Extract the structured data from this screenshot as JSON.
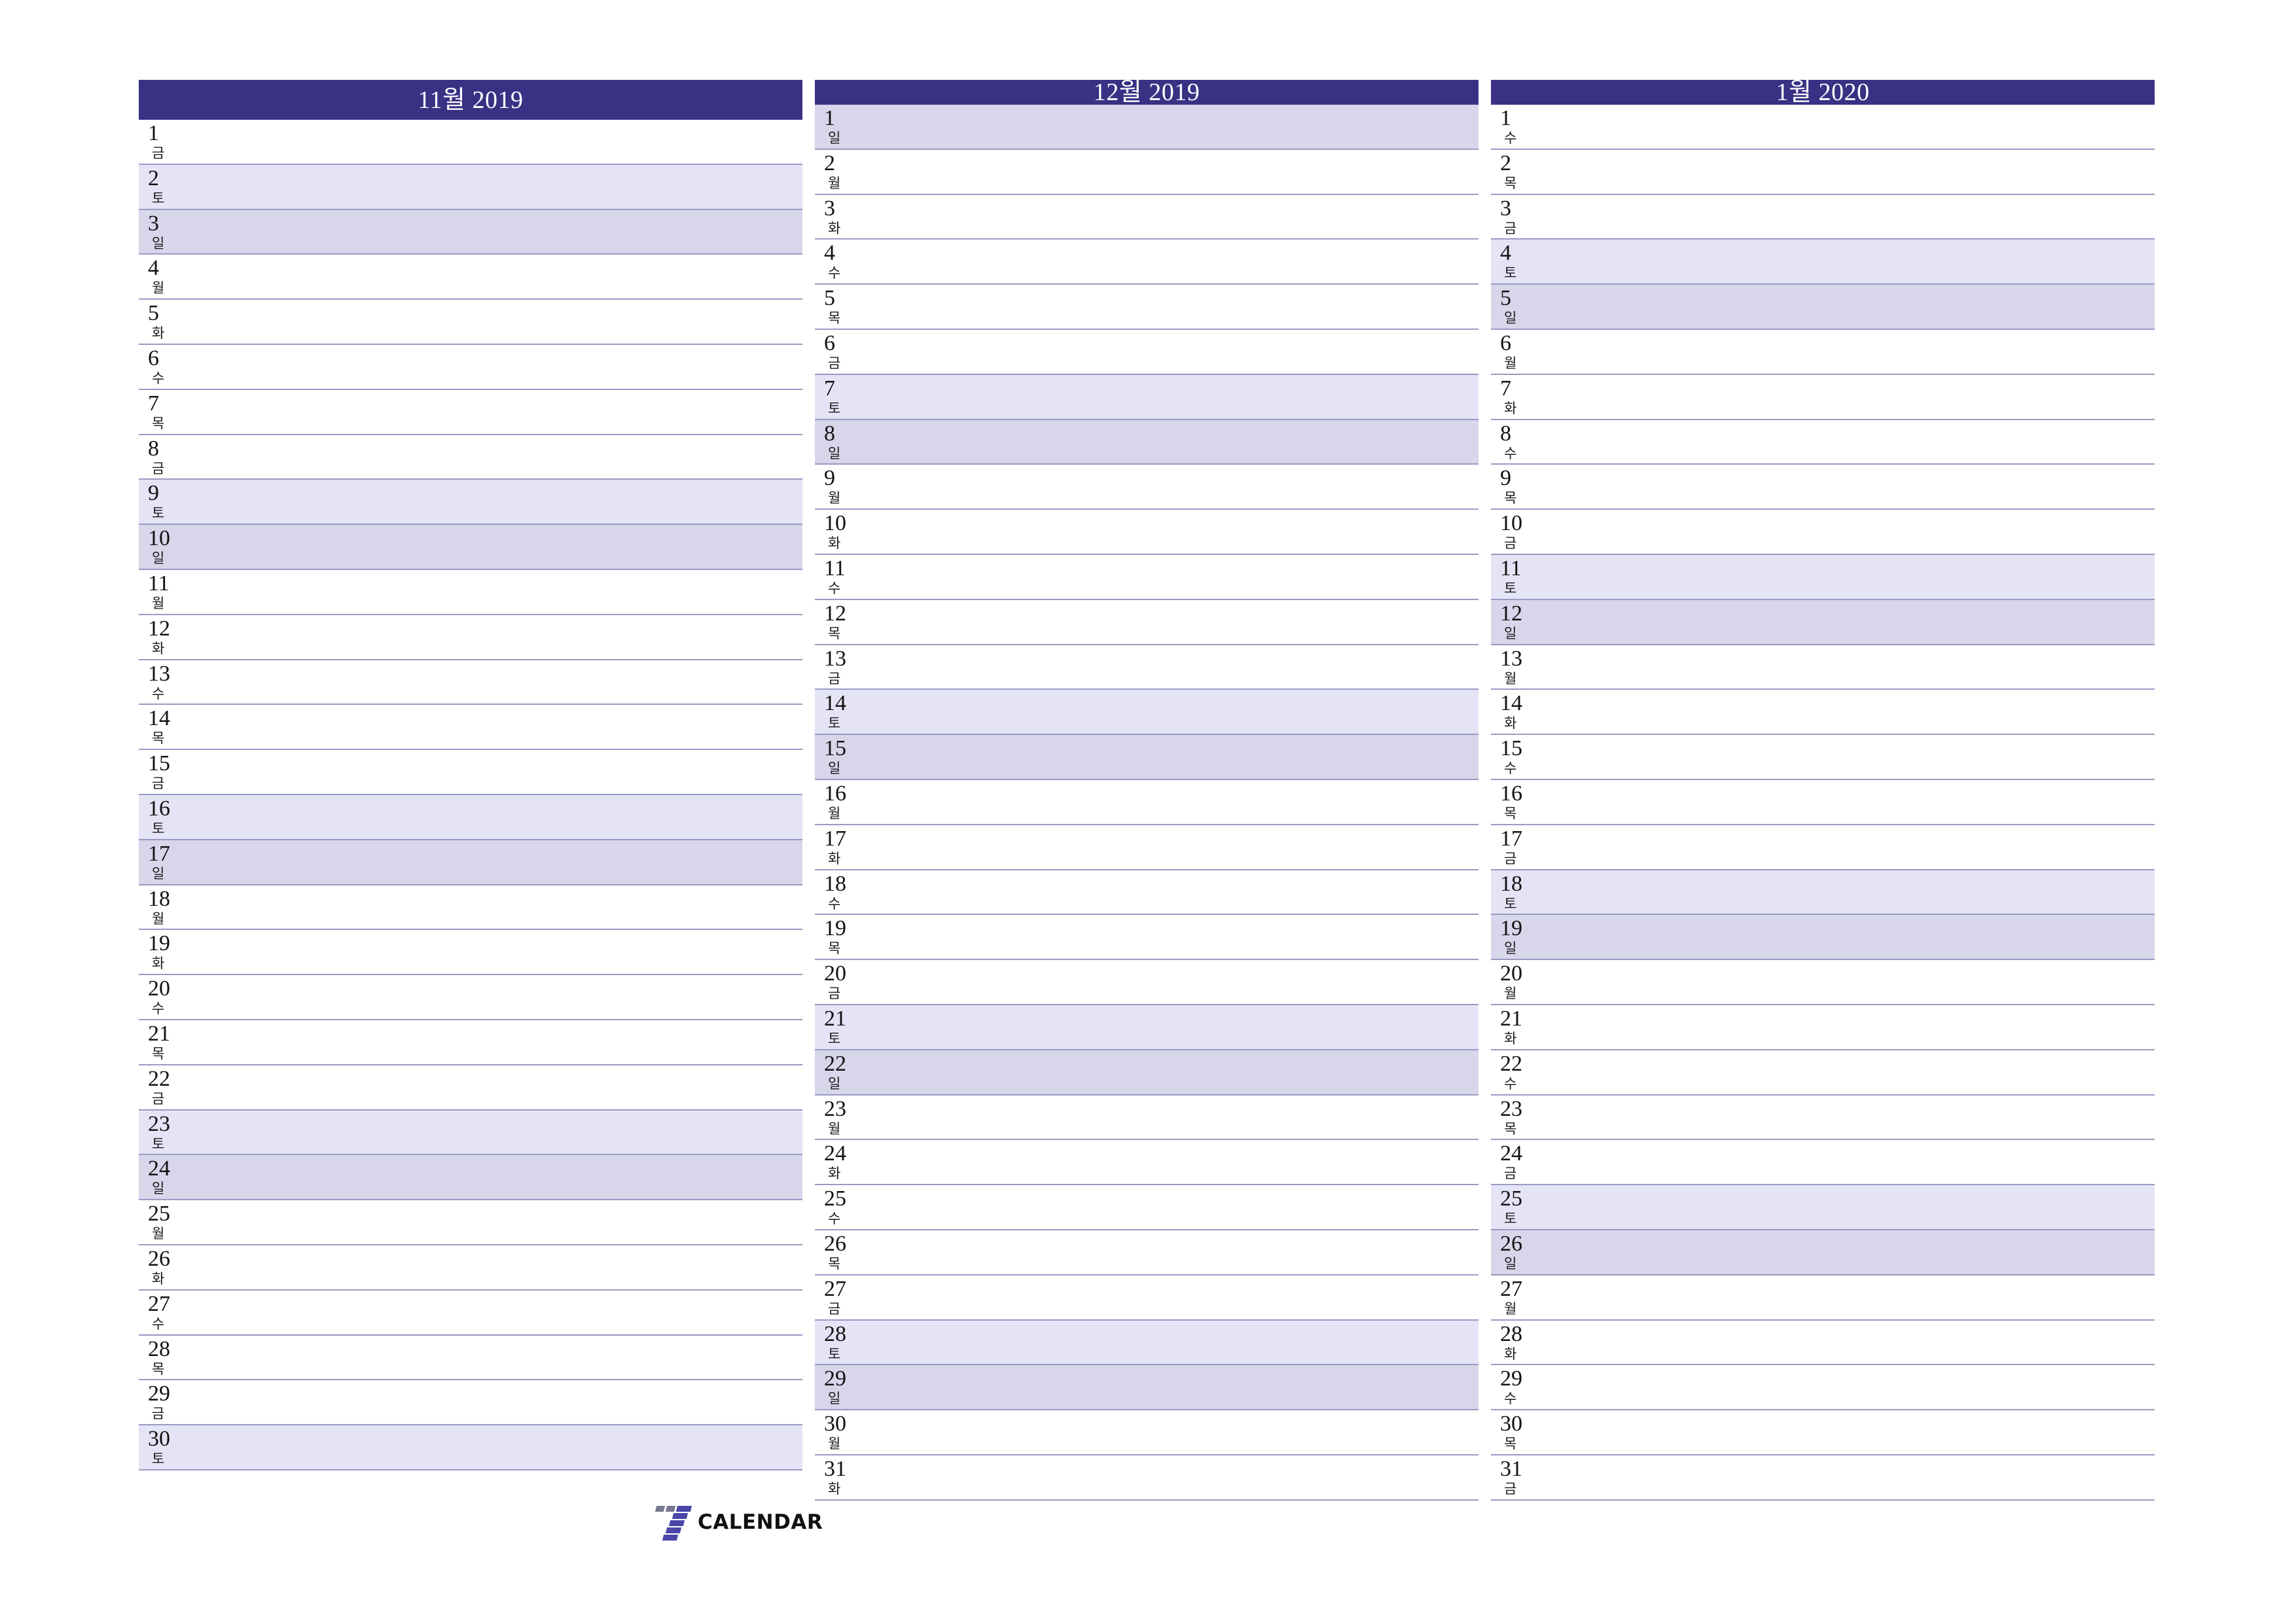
{
  "colors": {
    "header_bg": "#3a3185",
    "header_text": "#ffffff",
    "saturday_bg": "#e4e4f6",
    "sunday_bg": "#d8d6ea",
    "row_border": "#9a9ac4",
    "page_bg": "#ffffff",
    "logo_purple": "#4a46a8",
    "logo_gray": "#77778f"
  },
  "logo": {
    "mark_name": "seven-mark",
    "text": "CALENDAR"
  },
  "months": [
    {
      "title": "11월 2019",
      "days": [
        {
          "num": "1",
          "name": "금",
          "type": "weekday"
        },
        {
          "num": "2",
          "name": "토",
          "type": "sat"
        },
        {
          "num": "3",
          "name": "일",
          "type": "sun"
        },
        {
          "num": "4",
          "name": "월",
          "type": "weekday"
        },
        {
          "num": "5",
          "name": "화",
          "type": "weekday"
        },
        {
          "num": "6",
          "name": "수",
          "type": "weekday"
        },
        {
          "num": "7",
          "name": "목",
          "type": "weekday"
        },
        {
          "num": "8",
          "name": "금",
          "type": "weekday"
        },
        {
          "num": "9",
          "name": "토",
          "type": "sat"
        },
        {
          "num": "10",
          "name": "일",
          "type": "sun"
        },
        {
          "num": "11",
          "name": "월",
          "type": "weekday"
        },
        {
          "num": "12",
          "name": "화",
          "type": "weekday"
        },
        {
          "num": "13",
          "name": "수",
          "type": "weekday"
        },
        {
          "num": "14",
          "name": "목",
          "type": "weekday"
        },
        {
          "num": "15",
          "name": "금",
          "type": "weekday"
        },
        {
          "num": "16",
          "name": "토",
          "type": "sat"
        },
        {
          "num": "17",
          "name": "일",
          "type": "sun"
        },
        {
          "num": "18",
          "name": "월",
          "type": "weekday"
        },
        {
          "num": "19",
          "name": "화",
          "type": "weekday"
        },
        {
          "num": "20",
          "name": "수",
          "type": "weekday"
        },
        {
          "num": "21",
          "name": "목",
          "type": "weekday"
        },
        {
          "num": "22",
          "name": "금",
          "type": "weekday"
        },
        {
          "num": "23",
          "name": "토",
          "type": "sat"
        },
        {
          "num": "24",
          "name": "일",
          "type": "sun"
        },
        {
          "num": "25",
          "name": "월",
          "type": "weekday"
        },
        {
          "num": "26",
          "name": "화",
          "type": "weekday"
        },
        {
          "num": "27",
          "name": "수",
          "type": "weekday"
        },
        {
          "num": "28",
          "name": "목",
          "type": "weekday"
        },
        {
          "num": "29",
          "name": "금",
          "type": "weekday"
        },
        {
          "num": "30",
          "name": "토",
          "type": "sat"
        }
      ]
    },
    {
      "title": "12월 2019",
      "days": [
        {
          "num": "1",
          "name": "일",
          "type": "sun"
        },
        {
          "num": "2",
          "name": "월",
          "type": "weekday"
        },
        {
          "num": "3",
          "name": "화",
          "type": "weekday"
        },
        {
          "num": "4",
          "name": "수",
          "type": "weekday"
        },
        {
          "num": "5",
          "name": "목",
          "type": "weekday"
        },
        {
          "num": "6",
          "name": "금",
          "type": "weekday"
        },
        {
          "num": "7",
          "name": "토",
          "type": "sat"
        },
        {
          "num": "8",
          "name": "일",
          "type": "sun"
        },
        {
          "num": "9",
          "name": "월",
          "type": "weekday"
        },
        {
          "num": "10",
          "name": "화",
          "type": "weekday"
        },
        {
          "num": "11",
          "name": "수",
          "type": "weekday"
        },
        {
          "num": "12",
          "name": "목",
          "type": "weekday"
        },
        {
          "num": "13",
          "name": "금",
          "type": "weekday"
        },
        {
          "num": "14",
          "name": "토",
          "type": "sat"
        },
        {
          "num": "15",
          "name": "일",
          "type": "sun"
        },
        {
          "num": "16",
          "name": "월",
          "type": "weekday"
        },
        {
          "num": "17",
          "name": "화",
          "type": "weekday"
        },
        {
          "num": "18",
          "name": "수",
          "type": "weekday"
        },
        {
          "num": "19",
          "name": "목",
          "type": "weekday"
        },
        {
          "num": "20",
          "name": "금",
          "type": "weekday"
        },
        {
          "num": "21",
          "name": "토",
          "type": "sat"
        },
        {
          "num": "22",
          "name": "일",
          "type": "sun"
        },
        {
          "num": "23",
          "name": "월",
          "type": "weekday"
        },
        {
          "num": "24",
          "name": "화",
          "type": "weekday"
        },
        {
          "num": "25",
          "name": "수",
          "type": "weekday"
        },
        {
          "num": "26",
          "name": "목",
          "type": "weekday"
        },
        {
          "num": "27",
          "name": "금",
          "type": "weekday"
        },
        {
          "num": "28",
          "name": "토",
          "type": "sat"
        },
        {
          "num": "29",
          "name": "일",
          "type": "sun"
        },
        {
          "num": "30",
          "name": "월",
          "type": "weekday"
        },
        {
          "num": "31",
          "name": "화",
          "type": "weekday"
        }
      ]
    },
    {
      "title": "1월 2020",
      "days": [
        {
          "num": "1",
          "name": "수",
          "type": "weekday"
        },
        {
          "num": "2",
          "name": "목",
          "type": "weekday"
        },
        {
          "num": "3",
          "name": "금",
          "type": "weekday"
        },
        {
          "num": "4",
          "name": "토",
          "type": "sat"
        },
        {
          "num": "5",
          "name": "일",
          "type": "sun"
        },
        {
          "num": "6",
          "name": "월",
          "type": "weekday"
        },
        {
          "num": "7",
          "name": "화",
          "type": "weekday"
        },
        {
          "num": "8",
          "name": "수",
          "type": "weekday"
        },
        {
          "num": "9",
          "name": "목",
          "type": "weekday"
        },
        {
          "num": "10",
          "name": "금",
          "type": "weekday"
        },
        {
          "num": "11",
          "name": "토",
          "type": "sat"
        },
        {
          "num": "12",
          "name": "일",
          "type": "sun"
        },
        {
          "num": "13",
          "name": "월",
          "type": "weekday"
        },
        {
          "num": "14",
          "name": "화",
          "type": "weekday"
        },
        {
          "num": "15",
          "name": "수",
          "type": "weekday"
        },
        {
          "num": "16",
          "name": "목",
          "type": "weekday"
        },
        {
          "num": "17",
          "name": "금",
          "type": "weekday"
        },
        {
          "num": "18",
          "name": "토",
          "type": "sat"
        },
        {
          "num": "19",
          "name": "일",
          "type": "sun"
        },
        {
          "num": "20",
          "name": "월",
          "type": "weekday"
        },
        {
          "num": "21",
          "name": "화",
          "type": "weekday"
        },
        {
          "num": "22",
          "name": "수",
          "type": "weekday"
        },
        {
          "num": "23",
          "name": "목",
          "type": "weekday"
        },
        {
          "num": "24",
          "name": "금",
          "type": "weekday"
        },
        {
          "num": "25",
          "name": "토",
          "type": "sat"
        },
        {
          "num": "26",
          "name": "일",
          "type": "sun"
        },
        {
          "num": "27",
          "name": "월",
          "type": "weekday"
        },
        {
          "num": "28",
          "name": "화",
          "type": "weekday"
        },
        {
          "num": "29",
          "name": "수",
          "type": "weekday"
        },
        {
          "num": "30",
          "name": "목",
          "type": "weekday"
        },
        {
          "num": "31",
          "name": "금",
          "type": "weekday"
        }
      ]
    }
  ]
}
